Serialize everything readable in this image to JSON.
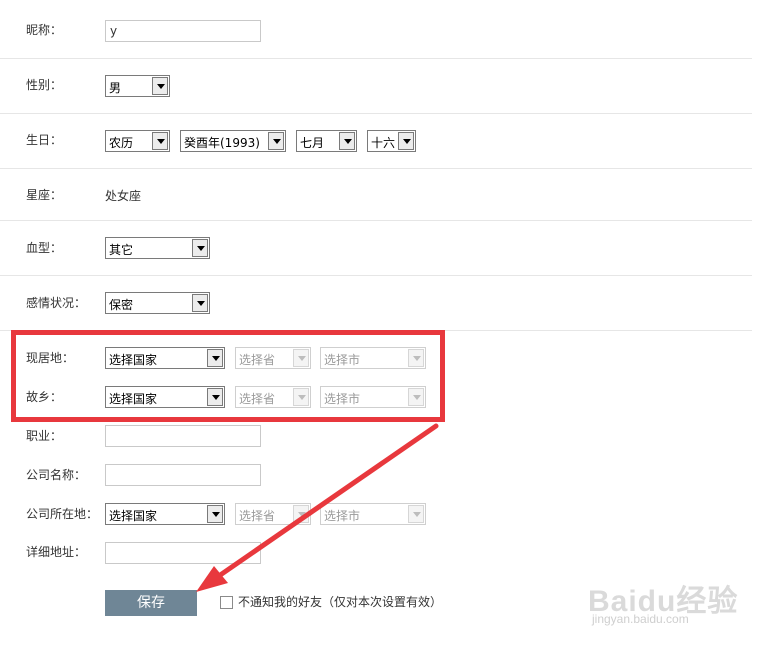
{
  "form": {
    "nickname": {
      "label": "昵称：",
      "value": "y"
    },
    "gender": {
      "label": "性别：",
      "value": "男"
    },
    "birthday": {
      "label": "生日：",
      "calendar": "农历",
      "year": "癸酉年(1993)",
      "month": "七月",
      "day": "十六"
    },
    "zodiac": {
      "label": "星座：",
      "value": "处女座"
    },
    "blood_type": {
      "label": "血型：",
      "value": "其它"
    },
    "relationship": {
      "label": "感情状况：",
      "value": "保密"
    },
    "current_residence": {
      "label": "现居地：",
      "country": "选择国家",
      "province": "选择省",
      "city": "选择市"
    },
    "hometown": {
      "label": "故乡：",
      "country": "选择国家",
      "province": "选择省",
      "city": "选择市"
    },
    "occupation": {
      "label": "职业：",
      "value": ""
    },
    "company_name": {
      "label": "公司名称：",
      "value": ""
    },
    "company_location": {
      "label": "公司所在地：",
      "country": "选择国家",
      "province": "选择省",
      "city": "选择市"
    },
    "address": {
      "label": "详细地址：",
      "value": ""
    }
  },
  "actions": {
    "save_label": "保存",
    "notify_label": "不通知我的好友（仅对本次设置有效）"
  },
  "watermark": {
    "brand": "Baidu经验",
    "url": "jingyan.baidu.com"
  },
  "colors": {
    "highlight": "#e8383d",
    "save_button": "#6f8696"
  }
}
